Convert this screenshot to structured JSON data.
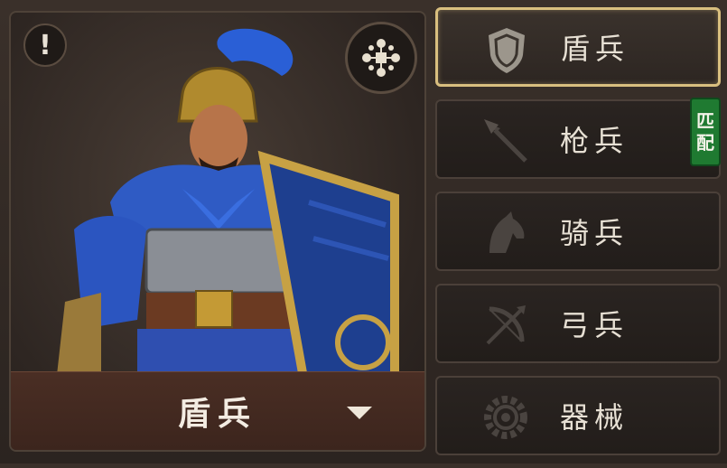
{
  "hero": {
    "name": "盾兵",
    "info_icon": "exclamation-icon",
    "formation_icon": "formation-icon"
  },
  "troops": [
    {
      "label": "盾兵",
      "icon": "shield-icon",
      "selected": true,
      "badge": ""
    },
    {
      "label": "枪兵",
      "icon": "spear-icon",
      "selected": false,
      "badge": [
        "匹",
        "配"
      ]
    },
    {
      "label": "骑兵",
      "icon": "horse-icon",
      "selected": false,
      "badge": ""
    },
    {
      "label": "弓兵",
      "icon": "bow-icon",
      "selected": false,
      "badge": ""
    },
    {
      "label": "器械",
      "icon": "gear-icon",
      "selected": false,
      "badge": ""
    }
  ],
  "colors": {
    "selected_border": "#d9bf7f",
    "badge_green": "#1f7a31",
    "text": "#e7e0d4"
  }
}
